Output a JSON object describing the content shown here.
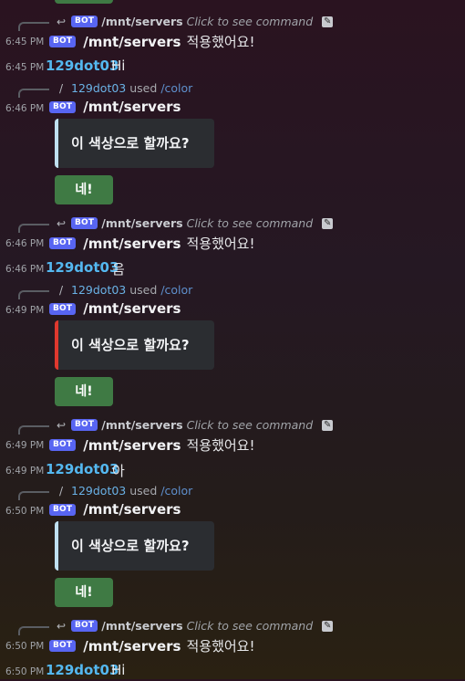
{
  "common": {
    "bot_badge": "BOT",
    "bot_name": "/mnt/servers",
    "click_hint": "Click to see command",
    "used_word": "used",
    "color_cmd": "/color",
    "applied_text": "적용했어요!",
    "embed_question": "이 색상으로 할까요?",
    "confirm_label": "네!",
    "user_name": "129dot03"
  },
  "messages": {
    "m1_time": "6:45 PM",
    "m2_time": "6:45 PM",
    "m2_text": "Hi",
    "m3_time": "6:46 PM",
    "m4_time": "6:46 PM",
    "m5_time": "6:46 PM",
    "m5_text": "음",
    "m6_time": "6:49 PM",
    "m7_time": "6:49 PM",
    "m8_time": "6:49 PM",
    "m8_text": "아",
    "m9_time": "6:50 PM",
    "m10_time": "6:50 PM",
    "m11_time": "6:50 PM",
    "m11_text": "Hi"
  },
  "colors": {
    "embed1_accent": "#bfe0f0",
    "embed2_accent": "#e0382e",
    "embed3_accent": "#bfe0f0",
    "button_green": "#3f7a44",
    "bot_badge": "#5865f2"
  },
  "icons": {
    "reply_glyph": "↩",
    "slash_glyph": "/",
    "edit_glyph": "✎"
  }
}
